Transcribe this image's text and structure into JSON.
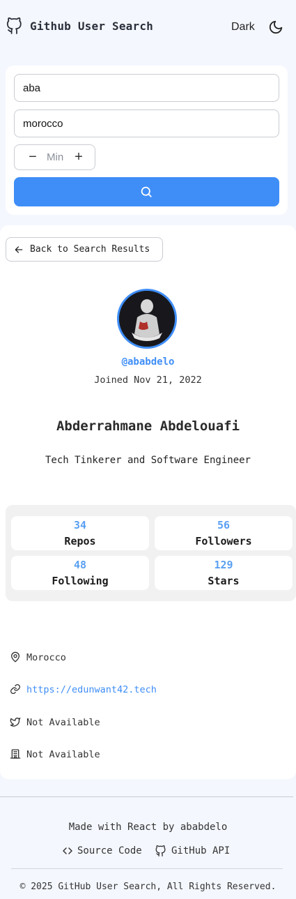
{
  "header": {
    "title": "Github User Search",
    "theme_label": "Dark",
    "logo_icon": "github-icon",
    "theme_icon": "moon-icon"
  },
  "search": {
    "username_value": "aba",
    "location_value": "morocco",
    "repos_min_placeholder": "Min",
    "minus_label": "−",
    "plus_label": "+",
    "button_icon": "search-icon",
    "button_color": "#3f8ef7"
  },
  "profile": {
    "back_label": "Back to Search Results",
    "username": "@ababdelo",
    "joined": "Joined Nov 21, 2022",
    "name": "Abderrahmane Abdelouafi",
    "bio": "Tech Tinkerer and Software Engineer",
    "stats": [
      {
        "value": "34",
        "label": "Repos"
      },
      {
        "value": "56",
        "label": "Followers"
      },
      {
        "value": "48",
        "label": "Following"
      },
      {
        "value": "129",
        "label": "Stars"
      }
    ],
    "info": {
      "location": "Morocco",
      "website": "https://edunwant42.tech",
      "twitter": "Not Available",
      "company": "Not Available"
    }
  },
  "footer": {
    "made_with": "Made with React by ababdelo",
    "source_label": "Source Code",
    "api_label": "GitHub API",
    "copyright": "© 2025 GitHub User Search, All Rights Reserved."
  },
  "colors": {
    "accent": "#3f8ef7",
    "stat_value": "#5aa0f2",
    "background": "#f4f7fd"
  }
}
